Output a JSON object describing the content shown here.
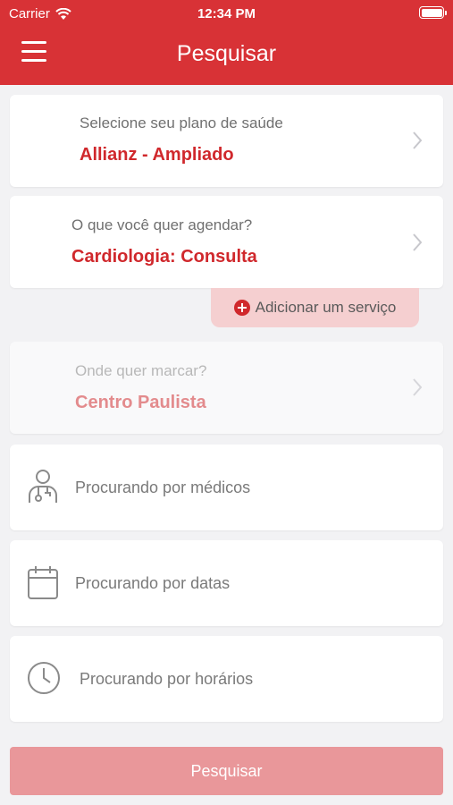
{
  "status_bar": {
    "carrier": "Carrier",
    "time": "12:34 PM"
  },
  "header": {
    "title": "Pesquisar",
    "menu_icon": "hamburger-menu-icon"
  },
  "plan": {
    "label": "Selecione seu plano de saúde",
    "value": "Allianz - Ampliado"
  },
  "service": {
    "label": "O que você quer agendar?",
    "value": "Cardiologia: Consulta"
  },
  "add_service": {
    "label": "Adicionar um serviço",
    "icon": "plus-circle-icon"
  },
  "location": {
    "label": "Onde quer marcar?",
    "value": "Centro Paulista"
  },
  "filters": {
    "doctors": {
      "label": "Procurando por médicos",
      "icon": "doctor-icon"
    },
    "dates": {
      "label": "Procurando por datas",
      "icon": "calendar-icon"
    },
    "times": {
      "label": "Procurando por horários",
      "icon": "clock-icon"
    }
  },
  "search_button": {
    "label": "Pesquisar"
  },
  "colors": {
    "brand": "#d83236",
    "accent_text": "#d0282c",
    "button_disabled": "#e9979a"
  }
}
